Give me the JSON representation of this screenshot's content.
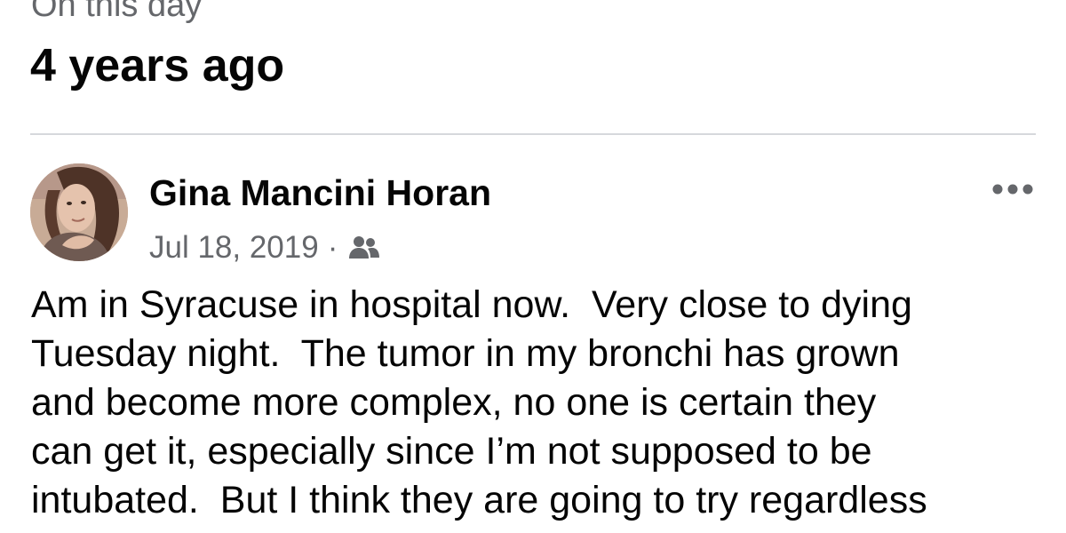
{
  "memory": {
    "kicker": "On this day",
    "title": "4 years ago"
  },
  "post": {
    "author": "Gina Mancini Horan",
    "date": "Jul 18, 2019",
    "separator": "·",
    "audience_icon": "friends-icon",
    "more_icon": "more-options-icon",
    "text_lines": [
      "Am in Syracuse in hospital now.  Very close to dying",
      "Tuesday night.  The tumor in my bronchi has grown",
      "and become more complex, no one is certain they",
      "can get it, especially since I’m not supposed to be",
      "intubated.  But I think they are going to try regardless"
    ]
  },
  "colors": {
    "text_primary": "#050505",
    "text_secondary": "#65676b",
    "divider": "#d6d8dc",
    "background": "#ffffff"
  }
}
